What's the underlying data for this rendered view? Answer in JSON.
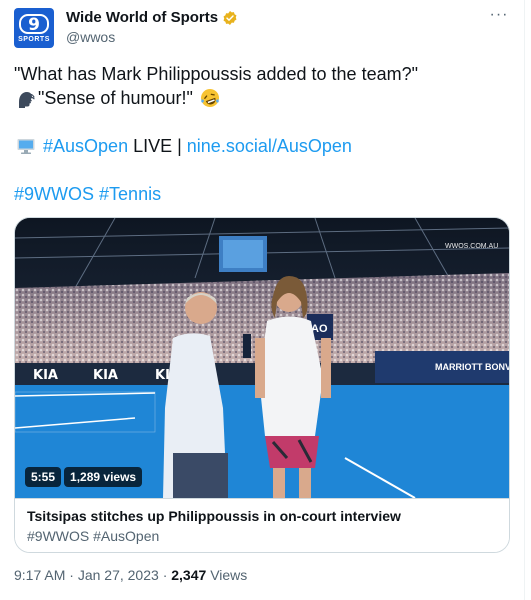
{
  "author": {
    "display_name": "Wide World of Sports",
    "handle": "@wwos",
    "avatar_text": "9",
    "avatar_subtext": "SPORTS",
    "verified_color": "#e8b21d"
  },
  "more_label": "···",
  "tweet": {
    "line1": "\"What has Mark Philippoussis added to the team?\"",
    "line2": "\"Sense of humour!\"",
    "live_hashtag": "#AusOpen",
    "live_text": " LIVE | ",
    "live_link": "nine.social/AusOpen",
    "hashtags": [
      "#9WWOS",
      "#Tennis"
    ]
  },
  "media": {
    "duration": "5:55",
    "views": "1,289 views",
    "title": "Tsitsipas stitches up Philippoussis in on-court interview",
    "subtitle": "#9WWOS #AusOpen",
    "watermark": "WWOS.COM.AU",
    "banner_text": "KIA",
    "sponsor": "MARRIOTT BONVOY",
    "ao_logo": "AO"
  },
  "meta": {
    "time": "9:17 AM",
    "date": "Jan 27, 2023",
    "views_count": "2,347",
    "views_label": "Views"
  },
  "colors": {
    "link": "#1d9bf0",
    "court": "#1f86d6",
    "brand": "#1a5fd0"
  },
  "icons": [
    "verified-badge-icon",
    "more-icon",
    "speaking-head-emoji",
    "laughing-emoji",
    "computer-emoji"
  ]
}
